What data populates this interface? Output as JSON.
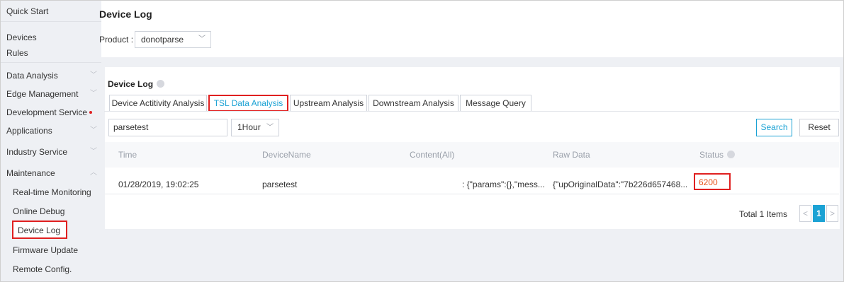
{
  "sidebar": {
    "items": [
      {
        "label": "Quick Start",
        "chevron": false
      },
      {
        "label": "Devices",
        "chevron": false
      },
      {
        "label": "Rules",
        "chevron": false
      },
      {
        "label": "Data Analysis",
        "chevron": true
      },
      {
        "label": "Edge Management",
        "chevron": true
      },
      {
        "label": "Development Service",
        "chevron": false,
        "dot": true
      },
      {
        "label": "Applications",
        "chevron": true
      },
      {
        "label": "Industry Service",
        "chevron": true
      },
      {
        "label": "Maintenance",
        "chevron": true,
        "expanded": true
      }
    ],
    "sub_items": [
      {
        "label": "Real-time Monitoring"
      },
      {
        "label": "Online Debug"
      },
      {
        "label": "Device Log",
        "active": true
      },
      {
        "label": "Firmware Update"
      },
      {
        "label": "Remote Config."
      }
    ]
  },
  "header": {
    "title": "Device Log",
    "product_label": "Product :",
    "product_value": "donotparse"
  },
  "panel": {
    "title": "Device Log",
    "tabs": [
      {
        "label": "Device Actitivity Analysis",
        "active": false
      },
      {
        "label": "TSL Data Analysis",
        "active": true
      },
      {
        "label": "Upstream Analysis",
        "active": false
      },
      {
        "label": "Downstream Analysis",
        "active": false
      },
      {
        "label": "Message Query",
        "active": false
      }
    ],
    "search_value": "parsetest",
    "time_range": "1Hour",
    "search_button": "Search",
    "reset_button": "Reset"
  },
  "table": {
    "columns": [
      "Time",
      "DeviceName",
      "Content(All)",
      "Raw Data",
      "Status"
    ],
    "rows": [
      {
        "time": "01/28/2019, 19:02:25",
        "device_name": "parsetest",
        "content": ": {\"params\":{},\"mess...",
        "raw_data": "{\"upOriginalData\":\"7b226d657468...",
        "status": "6200"
      }
    ]
  },
  "pagination": {
    "total": "Total 1 Items",
    "prev": "<",
    "current": "1",
    "next": ">"
  },
  "colors": {
    "accent": "#1ba2d4",
    "highlight": "#e02020",
    "status": "#e8541c"
  }
}
